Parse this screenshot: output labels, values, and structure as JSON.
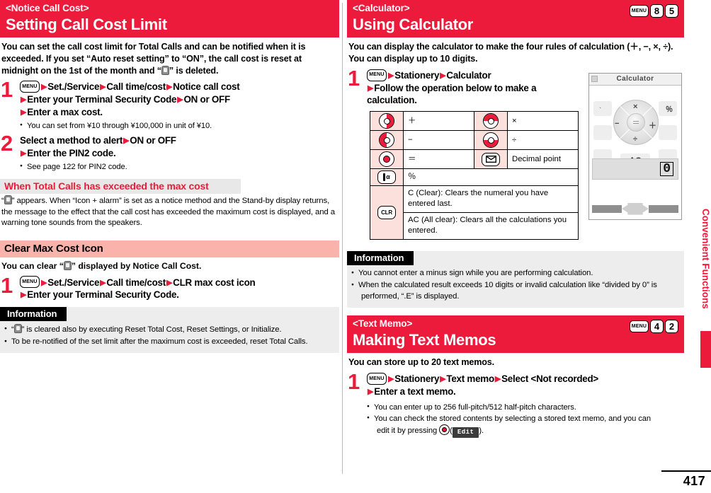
{
  "page": {
    "number": "417",
    "edge_tab_label": "Convenient Functions"
  },
  "left_column": {
    "section": {
      "eyebrow": "<Notice Call Cost>",
      "title": "Setting Call Cost Limit",
      "intro_a": "You can set the call cost limit for Total Calls and can be notified when it is exceeded. If you set “Auto reset setting” to “ON”, the call cost is reset at midnight on the 1st of the month and “",
      "intro_b": "” is deleted."
    },
    "steps": [
      {
        "number": "1",
        "menu_key": "MENU",
        "lines": [
          [
            "Set./Service",
            "Call time/cost",
            "Notice call cost"
          ],
          [
            "Enter your Terminal Security Code",
            "ON or OFF"
          ],
          [
            "Enter a max cost."
          ]
        ],
        "notes": [
          "You can set from ¥10 through ¥100,000 in unit of ¥10."
        ]
      },
      {
        "number": "2",
        "menu_key": "",
        "lines": [
          [
            "Select a method to alert",
            "ON or OFF"
          ],
          [
            "Enter the PIN2 code."
          ]
        ],
        "notes": [
          "See page 122 for PIN2 code."
        ]
      }
    ],
    "subheading_grey": "When Total Calls has exceeded the max cost",
    "exceeded_text_a": "“",
    "exceeded_text_b": "” appears. When “Icon + alarm” is set as a notice method and the Stand-by display returns, the message to the effect that the call cost has exceeded the maximum cost is displayed, and a warning tone sounds from the speakers.",
    "subheading_pink": "Clear Max Cost Icon",
    "clear_lead_a": "You can clear “",
    "clear_lead_b": "” displayed by Notice Call Cost.",
    "clear_step": {
      "number": "1",
      "menu_key": "MENU",
      "lines": [
        [
          "Set./Service",
          "Call time/cost",
          "CLR max cost icon"
        ],
        [
          "Enter your Terminal Security Code."
        ]
      ]
    },
    "information": {
      "title": "Information",
      "items": [
        {
          "pre": "“",
          "post": "” is cleared also by executing Reset Total Cost, Reset Settings, or Initialize.",
          "has_glyph": true
        },
        {
          "pre": "",
          "post": "To be re-notified of the set limit after the maximum cost is exceeded, reset Total Calls.",
          "has_glyph": false
        }
      ]
    }
  },
  "right_column": {
    "calculator": {
      "eyebrow": "<Calculator>",
      "title": "Using Calculator",
      "shortcut": {
        "menu": "MENU",
        "keys": [
          "8",
          "5"
        ]
      },
      "intro": "You can display the calculator to make the four rules of calculation (＋, −, ×, ÷). You can display up to 10 digits.",
      "step": {
        "number": "1",
        "menu_key": "MENU",
        "lines": [
          [
            "Stationery",
            "Calculator"
          ],
          [
            "Follow the operation below to make a"
          ],
          [
            "calculation."
          ]
        ]
      },
      "key_table": [
        {
          "left_key": "nav-right",
          "left_label": "＋",
          "right_key": "nav-up",
          "right_label": "×"
        },
        {
          "left_key": "nav-left",
          "left_label": "−",
          "right_key": "nav-down",
          "right_label": "÷"
        },
        {
          "left_key": "nav-center",
          "left_label": "＝",
          "right_key": "mail",
          "right_label": "Decimal point"
        }
      ],
      "key_table_wide": [
        {
          "key": "i-alpha",
          "label": "％"
        },
        {
          "key": "clr",
          "label": "C (Clear): Clears the numeral you have entered last.",
          "label2": "AC (All clear): Clears all the calculations you entered."
        }
      ],
      "phone_mock": {
        "title": "Calculator",
        "op_multiply": "×",
        "op_minus": "−",
        "op_plus": "＋",
        "op_divide": "÷",
        "op_equals": "＝",
        "dot": "·",
        "percent": "％",
        "ac": "AC",
        "result": "0"
      },
      "information": {
        "title": "Information",
        "items": [
          {
            "text": "You cannot enter a minus sign while you are performing calculation."
          },
          {
            "text": "When the calculated result exceeds 10 digits or invalid calculation like “divided by 0” is",
            "cont": "performed, “.E” is displayed."
          }
        ]
      }
    },
    "text_memo": {
      "eyebrow": "<Text Memo>",
      "title": "Making Text Memos",
      "shortcut": {
        "menu": "MENU",
        "keys": [
          "4",
          "2"
        ]
      },
      "intro": "You can store up to 20 text memos.",
      "step": {
        "number": "1",
        "menu_key": "MENU",
        "lines": [
          [
            "Stationery",
            "Text memo",
            "Select <Not recorded>"
          ],
          [
            "Enter a text memo."
          ]
        ]
      },
      "notes": [
        {
          "text": "You can enter up to 256 full-pitch/512 half-pitch characters."
        },
        {
          "text": "You can check the stored contents by selecting a stored text memo, and you can",
          "cont_pre": "edit it by pressing ",
          "soft_key": "Edit",
          "cont_post": ")."
        }
      ]
    }
  }
}
